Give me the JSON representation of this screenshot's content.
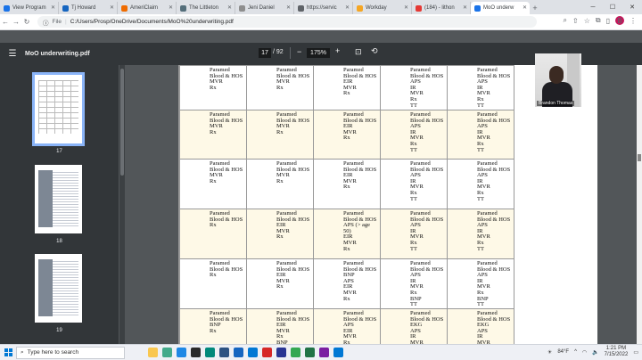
{
  "browser": {
    "tabs": [
      {
        "title": "View Program",
        "color": "#1a73e8",
        "active": false
      },
      {
        "title": "Tj Howard",
        "color": "#1565c0",
        "active": false
      },
      {
        "title": "AmeriClaim",
        "color": "#ef6c00",
        "active": false
      },
      {
        "title": "The Littleton",
        "color": "#546e7a",
        "active": false
      },
      {
        "title": "Jeni Daniel",
        "color": "#8e8e8e",
        "active": false
      },
      {
        "title": "https://servic",
        "color": "#5f6368",
        "active": false
      },
      {
        "title": "Workday",
        "color": "#f5a623",
        "active": false
      },
      {
        "title": "(184) - lithon",
        "color": "#e53935",
        "active": false
      },
      {
        "title": "MoO underw",
        "color": "#1a73e8",
        "active": true
      }
    ],
    "address": "C:/Users/Prosp/OneDrive/Documents/MoO%20underwriting.pdf",
    "address_prefix": "File",
    "profile_initial": "B"
  },
  "pdf": {
    "filename": "MoO underwriting.pdf",
    "current_page": "17",
    "total_pages": "/ 92",
    "zoom": "175%"
  },
  "thumbnails": [
    {
      "label": "17",
      "selected": true
    },
    {
      "label": "18",
      "selected": false
    },
    {
      "label": "19",
      "selected": false
    }
  ],
  "table_rows": [
    {
      "shaded": false,
      "cells": [
        [
          "Paramed",
          "Blood & HOS",
          "MVR",
          "Rx"
        ],
        [
          "Paramed",
          "Blood & HOS",
          "MVR",
          "Rx"
        ],
        [
          "Paramed",
          "Blood & HOS",
          "EIR",
          "MVR",
          "Rx"
        ],
        [
          "Paramed",
          "Blood & HOS",
          "APS",
          "IR",
          "MVR",
          "Rx",
          "TT"
        ],
        [
          "Paramed",
          "Blood & HOS",
          "APS",
          "IR",
          "MVR",
          "Rx",
          "TT"
        ]
      ]
    },
    {
      "shaded": true,
      "cells": [
        [
          "Paramed",
          "Blood & HOS",
          "MVR",
          "Rx"
        ],
        [
          "Paramed",
          "Blood & HOS",
          "MVR",
          "Rx"
        ],
        [
          "Paramed",
          "Blood & HOS",
          "EIR",
          "MVR",
          "Rx"
        ],
        [
          "Paramed",
          "Blood & HOS",
          "APS",
          "IR",
          "MVR",
          "Rx",
          "TT"
        ],
        [
          "Paramed",
          "Blood & HOS",
          "APS",
          "IR",
          "MVR",
          "Rx",
          "TT"
        ]
      ]
    },
    {
      "shaded": false,
      "cells": [
        [
          "Paramed",
          "Blood & HOS",
          "MVR",
          "Rx"
        ],
        [
          "Paramed",
          "Blood & HOS",
          "MVR",
          "Rx"
        ],
        [
          "Paramed",
          "Blood & HOS",
          "EIR",
          "MVR",
          "Rx"
        ],
        [
          "Paramed",
          "Blood & HOS",
          "APS",
          "IR",
          "MVR",
          "Rx",
          "TT"
        ],
        [
          "Paramed",
          "Blood & HOS",
          "APS",
          "IR",
          "MVR",
          "Rx",
          "TT"
        ]
      ]
    },
    {
      "shaded": true,
      "cells": [
        [
          "Paramed",
          "Blood & HOS",
          "Rx"
        ],
        [
          "Paramed",
          "Blood & HOS",
          "EIR",
          "MVR",
          "Rx"
        ],
        [
          "Paramed",
          "Blood & HOS",
          "APS (> age 50)",
          "EIR",
          "MVR",
          "Rx"
        ],
        [
          "Paramed",
          "Blood & HOS",
          "APS",
          "IR",
          "MVR",
          "Rx",
          "TT"
        ],
        [
          "Paramed",
          "Blood & HOS",
          "APS",
          "IR",
          "MVR",
          "Rx",
          "TT"
        ]
      ]
    },
    {
      "shaded": false,
      "cells": [
        [
          "Paramed",
          "Blood & HOS",
          "Rx"
        ],
        [
          "Paramed",
          "Blood & HOS",
          "EIR",
          "MVR",
          "Rx"
        ],
        [
          "Paramed",
          "Blood & HOS",
          "BNP",
          "APS",
          "EIR",
          "MVR",
          "Rx"
        ],
        [
          "Paramed",
          "Blood & HOS",
          "APS",
          "IR",
          "MVR",
          "Rx",
          "BNP",
          "TT"
        ],
        [
          "Paramed",
          "Blood & HOS",
          "APS",
          "IR",
          "MVR",
          "Rx",
          "BNP",
          "TT"
        ]
      ]
    },
    {
      "shaded": true,
      "cells": [
        [
          "Paramed",
          "Blood & HOS",
          "BNP",
          "Rx"
        ],
        [
          "Paramed",
          "Blood & HOS",
          "EIR",
          "MVR",
          "Rx",
          "BNP"
        ],
        [
          "Paramed",
          "Blood & HOS",
          "APS",
          "EIR",
          "MVR",
          "Rx"
        ],
        [
          "Paramed",
          "Blood & HOS",
          "EKG",
          "APS",
          "IR",
          "MVR"
        ],
        [
          "Paramed",
          "Blood & HOS",
          "EKG",
          "APS",
          "IR",
          "MVR"
        ]
      ]
    }
  ],
  "webcam": {
    "name": "Brandon Thomas"
  },
  "taskbar": {
    "search_placeholder": "Type here to search",
    "weather": "84°F",
    "time": "1:21 PM",
    "date": "7/15/2022",
    "app_colors": [
      "#f9c74f",
      "#43aa8b",
      "#1e88e5",
      "#2b2b2b",
      "#00897b",
      "#2c5282",
      "#1565c0",
      "#0078d4",
      "#d62828",
      "#283593",
      "#34a853",
      "#217346",
      "#7b1fa2",
      "#0078d4"
    ]
  }
}
